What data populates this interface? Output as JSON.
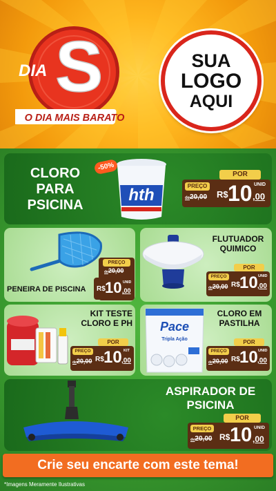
{
  "header": {
    "badge_small": "DIA",
    "badge_big": "S",
    "badge_caption": "O DIA MAIS BARATO",
    "logo_line1": "SUA",
    "logo_line2": "LOGO",
    "logo_line3": "AQUI"
  },
  "products": {
    "cloro": {
      "name": "CLORO PARA PSICINA",
      "discount": "-50%",
      "brand": "hth",
      "price": {
        "por": "POR",
        "preco": "PREÇO",
        "de": "de",
        "old": "20,00",
        "currency": "R$",
        "int": "10",
        "cents": ",00",
        "unit": "UNID"
      }
    },
    "peneira": {
      "name": "PENEIRA DE PISCINA",
      "price": {
        "por": "PREÇO",
        "de": "de",
        "old": "20,00",
        "currency": "R$",
        "int": "10",
        "cents": ",00",
        "unit": "UNID"
      }
    },
    "flutuador": {
      "name": "FLUTUADOR QUIMICO",
      "price": {
        "por": "POR",
        "preco": "PREÇO",
        "de": "de",
        "old": "20,00",
        "currency": "R$",
        "int": "10",
        "cents": ",00",
        "unit": "UNID"
      }
    },
    "kit": {
      "name": "KIT TESTE CLORO E PH",
      "price": {
        "por": "POR",
        "preco": "PREÇO",
        "de": "de",
        "old": "20,00",
        "currency": "R$",
        "int": "10",
        "cents": ",00",
        "unit": "KIT"
      }
    },
    "pastilha": {
      "name": "CLORO EM PASTILHA",
      "brand": "Pace",
      "brand_sub": "Tripla Ação",
      "price": {
        "por": "POR",
        "preco": "PREÇO",
        "de": "de",
        "old": "20,00",
        "currency": "R$",
        "int": "10",
        "cents": ",00",
        "unit": "UNID"
      }
    },
    "aspirador": {
      "name": "ASPIRADOR DE PSICINA",
      "price": {
        "por": "POR",
        "preco": "PREÇO",
        "de": "de",
        "old": "20,00",
        "currency": "R$",
        "int": "10",
        "cents": ",00",
        "unit": "UNID"
      }
    }
  },
  "footer": {
    "cta": "Crie seu encarte com este tema!",
    "disclaimer": "*Imagens Meramente Ilustrativas"
  },
  "colors": {
    "orange_bg": "#f39a0c",
    "red_badge": "#d9261c",
    "green_bg": "#3a9c2f",
    "price_brown": "#5b2e14",
    "price_yellow": "#f2ce4a",
    "cta_orange": "#f26d21"
  }
}
